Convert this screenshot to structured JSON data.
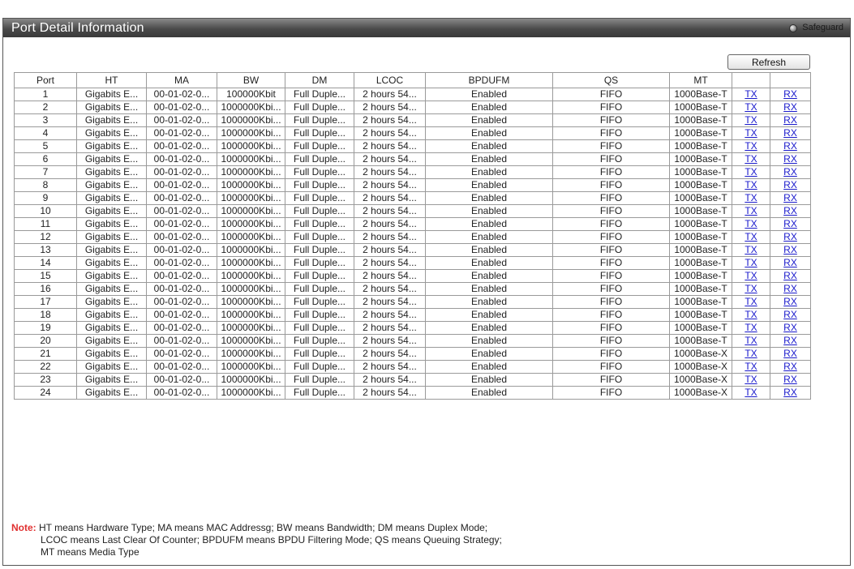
{
  "panel": {
    "title": "Port Detail Information",
    "safeguard_label": "Safeguard"
  },
  "toolbar": {
    "refresh_label": "Refresh"
  },
  "table": {
    "headers": [
      "Port",
      "HT",
      "MA",
      "BW",
      "DM",
      "LCOC",
      "BPDUFM",
      "QS",
      "MT",
      "",
      ""
    ],
    "rows": [
      [
        "1",
        "Gigabits E...",
        "00-01-02-0...",
        "100000Kbit",
        "Full Duple...",
        "2 hours 54...",
        "Enabled",
        "FIFO",
        "1000Base-T",
        "TX",
        "RX"
      ],
      [
        "2",
        "Gigabits E...",
        "00-01-02-0...",
        "1000000Kbi...",
        "Full Duple...",
        "2 hours 54...",
        "Enabled",
        "FIFO",
        "1000Base-T",
        "TX",
        "RX"
      ],
      [
        "3",
        "Gigabits E...",
        "00-01-02-0...",
        "1000000Kbi...",
        "Full Duple...",
        "2 hours 54...",
        "Enabled",
        "FIFO",
        "1000Base-T",
        "TX",
        "RX"
      ],
      [
        "4",
        "Gigabits E...",
        "00-01-02-0...",
        "1000000Kbi...",
        "Full Duple...",
        "2 hours 54...",
        "Enabled",
        "FIFO",
        "1000Base-T",
        "TX",
        "RX"
      ],
      [
        "5",
        "Gigabits E...",
        "00-01-02-0...",
        "1000000Kbi...",
        "Full Duple...",
        "2 hours 54...",
        "Enabled",
        "FIFO",
        "1000Base-T",
        "TX",
        "RX"
      ],
      [
        "6",
        "Gigabits E...",
        "00-01-02-0...",
        "1000000Kbi...",
        "Full Duple...",
        "2 hours 54...",
        "Enabled",
        "FIFO",
        "1000Base-T",
        "TX",
        "RX"
      ],
      [
        "7",
        "Gigabits E...",
        "00-01-02-0...",
        "1000000Kbi...",
        "Full Duple...",
        "2 hours 54...",
        "Enabled",
        "FIFO",
        "1000Base-T",
        "TX",
        "RX"
      ],
      [
        "8",
        "Gigabits E...",
        "00-01-02-0...",
        "1000000Kbi...",
        "Full Duple...",
        "2 hours 54...",
        "Enabled",
        "FIFO",
        "1000Base-T",
        "TX",
        "RX"
      ],
      [
        "9",
        "Gigabits E...",
        "00-01-02-0...",
        "1000000Kbi...",
        "Full Duple...",
        "2 hours 54...",
        "Enabled",
        "FIFO",
        "1000Base-T",
        "TX",
        "RX"
      ],
      [
        "10",
        "Gigabits E...",
        "00-01-02-0...",
        "1000000Kbi...",
        "Full Duple...",
        "2 hours 54...",
        "Enabled",
        "FIFO",
        "1000Base-T",
        "TX",
        "RX"
      ],
      [
        "11",
        "Gigabits E...",
        "00-01-02-0...",
        "1000000Kbi...",
        "Full Duple...",
        "2 hours 54...",
        "Enabled",
        "FIFO",
        "1000Base-T",
        "TX",
        "RX"
      ],
      [
        "12",
        "Gigabits E...",
        "00-01-02-0...",
        "1000000Kbi...",
        "Full Duple...",
        "2 hours 54...",
        "Enabled",
        "FIFO",
        "1000Base-T",
        "TX",
        "RX"
      ],
      [
        "13",
        "Gigabits E...",
        "00-01-02-0...",
        "1000000Kbi...",
        "Full Duple...",
        "2 hours 54...",
        "Enabled",
        "FIFO",
        "1000Base-T",
        "TX",
        "RX"
      ],
      [
        "14",
        "Gigabits E...",
        "00-01-02-0...",
        "1000000Kbi...",
        "Full Duple...",
        "2 hours 54...",
        "Enabled",
        "FIFO",
        "1000Base-T",
        "TX",
        "RX"
      ],
      [
        "15",
        "Gigabits E...",
        "00-01-02-0...",
        "1000000Kbi...",
        "Full Duple...",
        "2 hours 54...",
        "Enabled",
        "FIFO",
        "1000Base-T",
        "TX",
        "RX"
      ],
      [
        "16",
        "Gigabits E...",
        "00-01-02-0...",
        "1000000Kbi...",
        "Full Duple...",
        "2 hours 54...",
        "Enabled",
        "FIFO",
        "1000Base-T",
        "TX",
        "RX"
      ],
      [
        "17",
        "Gigabits E...",
        "00-01-02-0...",
        "1000000Kbi...",
        "Full Duple...",
        "2 hours 54...",
        "Enabled",
        "FIFO",
        "1000Base-T",
        "TX",
        "RX"
      ],
      [
        "18",
        "Gigabits E...",
        "00-01-02-0...",
        "1000000Kbi...",
        "Full Duple...",
        "2 hours 54...",
        "Enabled",
        "FIFO",
        "1000Base-T",
        "TX",
        "RX"
      ],
      [
        "19",
        "Gigabits E...",
        "00-01-02-0...",
        "1000000Kbi...",
        "Full Duple...",
        "2 hours 54...",
        "Enabled",
        "FIFO",
        "1000Base-T",
        "TX",
        "RX"
      ],
      [
        "20",
        "Gigabits E...",
        "00-01-02-0...",
        "1000000Kbi...",
        "Full Duple...",
        "2 hours 54...",
        "Enabled",
        "FIFO",
        "1000Base-T",
        "TX",
        "RX"
      ],
      [
        "21",
        "Gigabits E...",
        "00-01-02-0...",
        "1000000Kbi...",
        "Full Duple...",
        "2 hours 54...",
        "Enabled",
        "FIFO",
        "1000Base-X",
        "TX",
        "RX"
      ],
      [
        "22",
        "Gigabits E...",
        "00-01-02-0...",
        "1000000Kbi...",
        "Full Duple...",
        "2 hours 54...",
        "Enabled",
        "FIFO",
        "1000Base-X",
        "TX",
        "RX"
      ],
      [
        "23",
        "Gigabits E...",
        "00-01-02-0...",
        "1000000Kbi...",
        "Full Duple...",
        "2 hours 54...",
        "Enabled",
        "FIFO",
        "1000Base-X",
        "TX",
        "RX"
      ],
      [
        "24",
        "Gigabits E...",
        "00-01-02-0...",
        "1000000Kbi...",
        "Full Duple...",
        "2 hours 54...",
        "Enabled",
        "FIFO",
        "1000Base-X",
        "TX",
        "RX"
      ]
    ]
  },
  "note": {
    "label": "Note:",
    "line1": "HT means Hardware Type;  MA means MAC Addressg;  BW means Bandwidth;  DM means Duplex Mode;",
    "line2": "LCOC means Last Clear Of Counter; BPDUFM means BPDU Filtering Mode; QS means Queuing Strategy;",
    "line3": "MT means Media Type"
  },
  "colors": {
    "title_bar": "#4a4a4a",
    "link": "#1a1acc",
    "note_label": "#e03030"
  }
}
